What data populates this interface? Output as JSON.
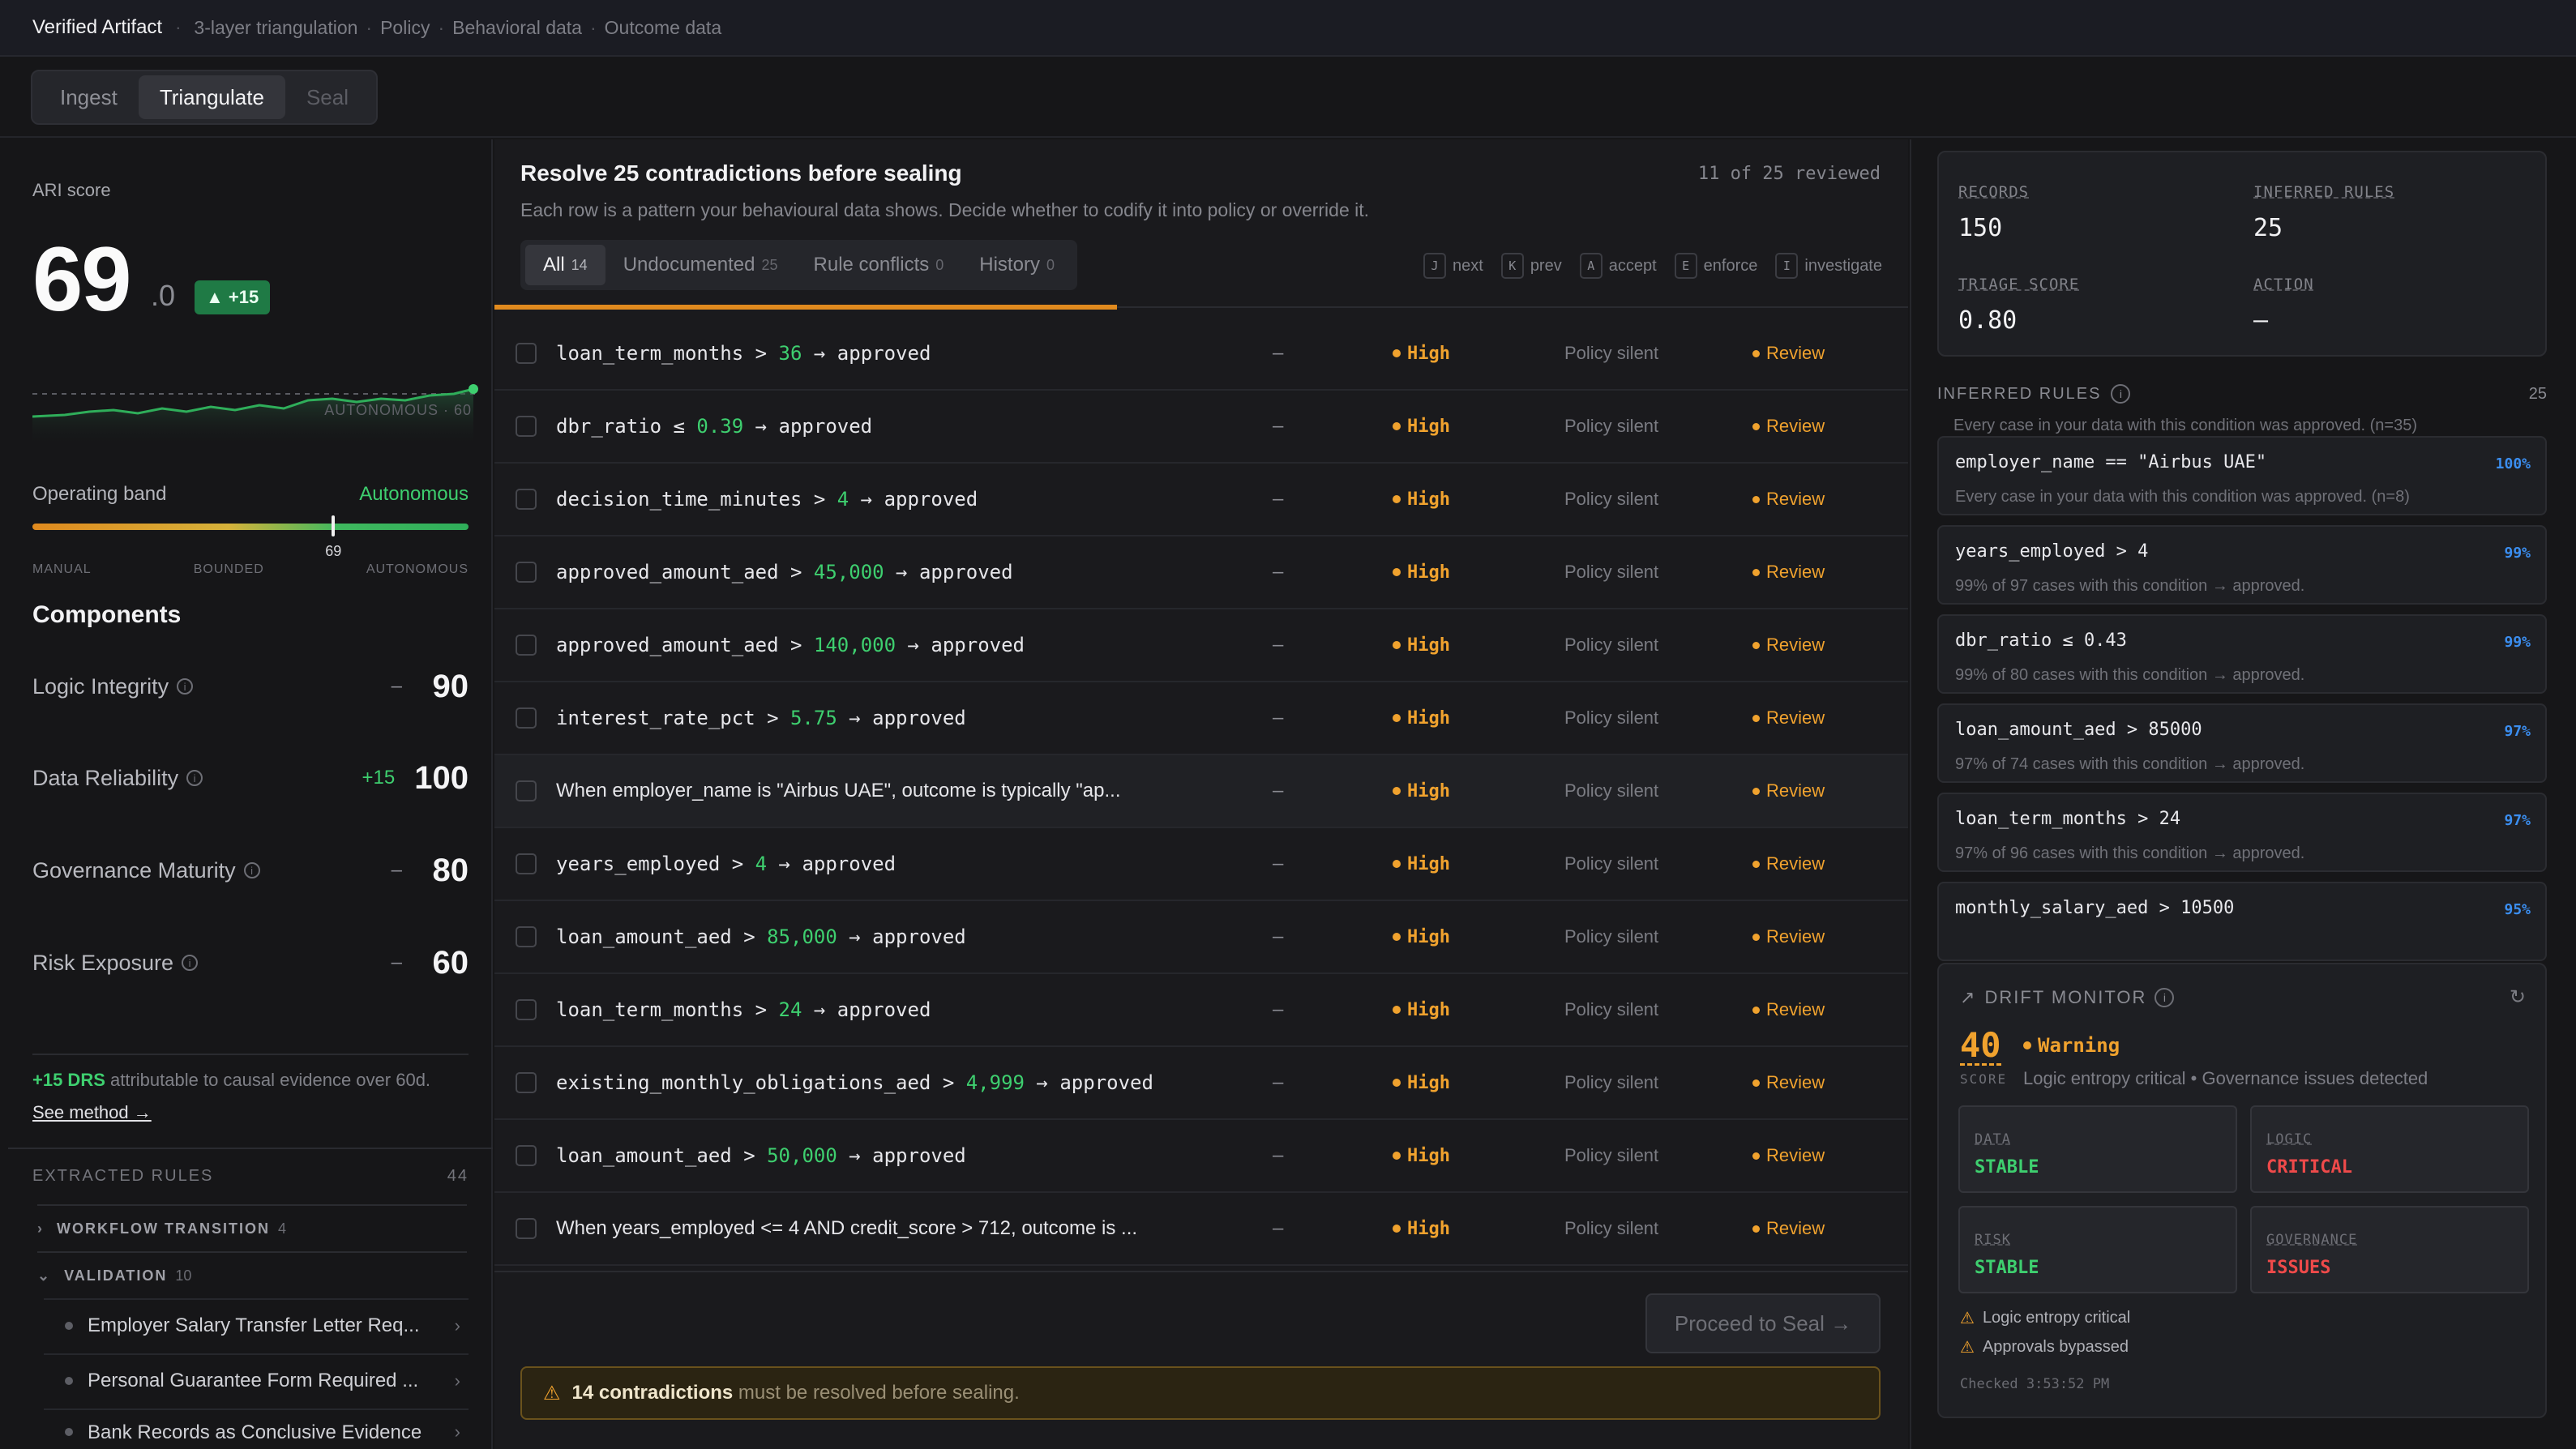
{
  "topbar": {
    "brand": "Verified Artifact",
    "crumbs": [
      "3-layer triangulation",
      "Policy",
      "Behavioral data",
      "Outcome data"
    ]
  },
  "steps": [
    "Ingest",
    "Triangulate",
    "Seal"
  ],
  "left": {
    "ari_label": "ARI score",
    "ari_int": "69",
    "ari_dec": ".0",
    "ari_delta": "▲ +15",
    "spark_label": "AUTONOMOUS · 60",
    "band_label": "Operating band",
    "band_value": "Autonomous",
    "band_marker": "69",
    "band_marker_value": 69,
    "band_scale": [
      "MANUAL",
      "BOUNDED",
      "AUTONOMOUS"
    ],
    "components_title": "Components",
    "components": [
      {
        "name": "Logic Integrity",
        "delta": "–",
        "score": "90"
      },
      {
        "name": "Data Reliability",
        "delta": "+15",
        "score": "100"
      },
      {
        "name": "Governance Maturity",
        "delta": "–",
        "score": "80"
      },
      {
        "name": "Risk Exposure",
        "delta": "–",
        "score": "60"
      }
    ],
    "drs_strong": "+15 DRS",
    "drs_text": " attributable to causal evidence over 60d.",
    "drs_link": "See method →",
    "extracted_title": "EXTRACTED RULES",
    "extracted_count": "44",
    "groups": [
      {
        "name": "WORKFLOW TRANSITION",
        "count": "4",
        "chev": "›"
      },
      {
        "name": "VALIDATION",
        "count": "10",
        "chev": "⌄"
      }
    ],
    "rules": [
      "Employer Salary Transfer Letter Req...",
      "Personal Guarantee Form Required ...",
      "Bank Records as Conclusive Evidence"
    ]
  },
  "center": {
    "title": "Resolve 25 contradictions before sealing",
    "subtitle": "Each row is a pattern your behavioural data shows. Decide whether to codify it into policy or override it.",
    "reviewed": "11 of 25 reviewed",
    "tabs": [
      {
        "label": "All",
        "count": "14"
      },
      {
        "label": "Undocumented",
        "count": "25"
      },
      {
        "label": "Rule conflicts",
        "count": "0"
      },
      {
        "label": "History",
        "count": "0"
      }
    ],
    "shortcuts": [
      {
        "key": "J",
        "label": "next"
      },
      {
        "key": "K",
        "label": "prev"
      },
      {
        "key": "A",
        "label": "accept"
      },
      {
        "key": "E",
        "label": "enforce"
      },
      {
        "key": "I",
        "label": "investigate"
      }
    ],
    "rows": [
      {
        "pre": "loan_term_months > ",
        "num": "36",
        "post": " → approved",
        "dash": "–",
        "severity": "High",
        "policy": "Policy silent",
        "action": "Review"
      },
      {
        "pre": "dbr_ratio ≤ ",
        "num": "0.39",
        "post": " → approved",
        "dash": "–",
        "severity": "High",
        "policy": "Policy silent",
        "action": "Review"
      },
      {
        "pre": "decision_time_minutes > ",
        "num": "4",
        "post": " → approved",
        "dash": "–",
        "severity": "High",
        "policy": "Policy silent",
        "action": "Review"
      },
      {
        "pre": "approved_amount_aed > ",
        "num": "45,000",
        "post": " → approved",
        "dash": "–",
        "severity": "High",
        "policy": "Policy silent",
        "action": "Review"
      },
      {
        "pre": "approved_amount_aed > ",
        "num": "140,000",
        "post": " → approved",
        "dash": "–",
        "severity": "High",
        "policy": "Policy silent",
        "action": "Review"
      },
      {
        "pre": "interest_rate_pct > ",
        "num": "5.75",
        "post": " → approved",
        "dash": "–",
        "severity": "High",
        "policy": "Policy silent",
        "action": "Review"
      },
      {
        "text": "When employer_name is \"Airbus UAE\", outcome is typically \"ap...",
        "dash": "–",
        "severity": "High",
        "policy": "Policy silent",
        "action": "Review"
      },
      {
        "pre": "years_employed > ",
        "num": "4",
        "post": " → approved",
        "dash": "–",
        "severity": "High",
        "policy": "Policy silent",
        "action": "Review"
      },
      {
        "pre": "loan_amount_aed > ",
        "num": "85,000",
        "post": " → approved",
        "dash": "–",
        "severity": "High",
        "policy": "Policy silent",
        "action": "Review"
      },
      {
        "pre": "loan_term_months > ",
        "num": "24",
        "post": " → approved",
        "dash": "–",
        "severity": "High",
        "policy": "Policy silent",
        "action": "Review"
      },
      {
        "pre": "existing_monthly_obligations_aed > ",
        "num": "4,999",
        "post": " → approved",
        "dash": "–",
        "severity": "High",
        "policy": "Policy silent",
        "action": "Review"
      },
      {
        "pre": "loan_amount_aed > ",
        "num": "50,000",
        "post": " → approved",
        "dash": "–",
        "severity": "High",
        "policy": "Policy silent",
        "action": "Review"
      },
      {
        "text": "When years_employed <= 4 AND credit_score > 712, outcome is ...",
        "dash": "–",
        "severity": "High",
        "policy": "Policy silent",
        "action": "Review"
      }
    ],
    "proceed": "Proceed to Seal →",
    "warn_strong": "14 contradictions",
    "warn_text": "must be resolved before sealing."
  },
  "right": {
    "stats": [
      {
        "label": "RECORDS",
        "value": "150"
      },
      {
        "label": "INFERRED RULES",
        "value": "25"
      },
      {
        "label": "TRIAGE SCORE",
        "value": "0.80"
      },
      {
        "label": "ACTION",
        "value": "—"
      }
    ],
    "inferred_title": "INFERRED RULES",
    "inferred_count": "25",
    "inferred_top_desc": "Every case in your data with this condition was approved. (n=35)",
    "inferred": [
      {
        "cond": "employer_name == \"Airbus UAE\"",
        "pct": "100%",
        "desc": "Every case in your data with this condition was approved. (n=8)"
      },
      {
        "cond": "years_employed > 4",
        "pct": "99%",
        "desc": "99% of 97 cases with this condition → approved."
      },
      {
        "cond": "dbr_ratio ≤ 0.43",
        "pct": "99%",
        "desc": "99% of 80 cases with this condition → approved."
      },
      {
        "cond": "loan_amount_aed > 85000",
        "pct": "97%",
        "desc": "97% of 74 cases with this condition → approved."
      },
      {
        "cond": "loan_term_months > 24",
        "pct": "97%",
        "desc": "97% of 96 cases with this condition → approved."
      },
      {
        "cond": "monthly_salary_aed > 10500",
        "pct": "95%",
        "desc": ""
      }
    ],
    "drift": {
      "title": "DRIFT MONITOR",
      "score": "40",
      "score_label": "SCORE",
      "status": "Warning",
      "desc": "Logic entropy critical • Governance issues detected",
      "boxes": [
        {
          "label": "DATA",
          "value": "STABLE",
          "state": "ok"
        },
        {
          "label": "LOGIC",
          "value": "CRITICAL",
          "state": "bad"
        },
        {
          "label": "RISK",
          "value": "STABLE",
          "state": "ok"
        },
        {
          "label": "GOVERNANCE",
          "value": "ISSUES",
          "state": "bad"
        }
      ],
      "warnings": [
        "Logic entropy critical",
        "Approvals bypassed"
      ],
      "checked": "Checked 3:53:52 PM"
    }
  },
  "colors": {
    "accent_orange": "#f0a22e",
    "green": "#3ecf6f",
    "red": "#ef4a4a",
    "blue": "#3b8ef0"
  }
}
